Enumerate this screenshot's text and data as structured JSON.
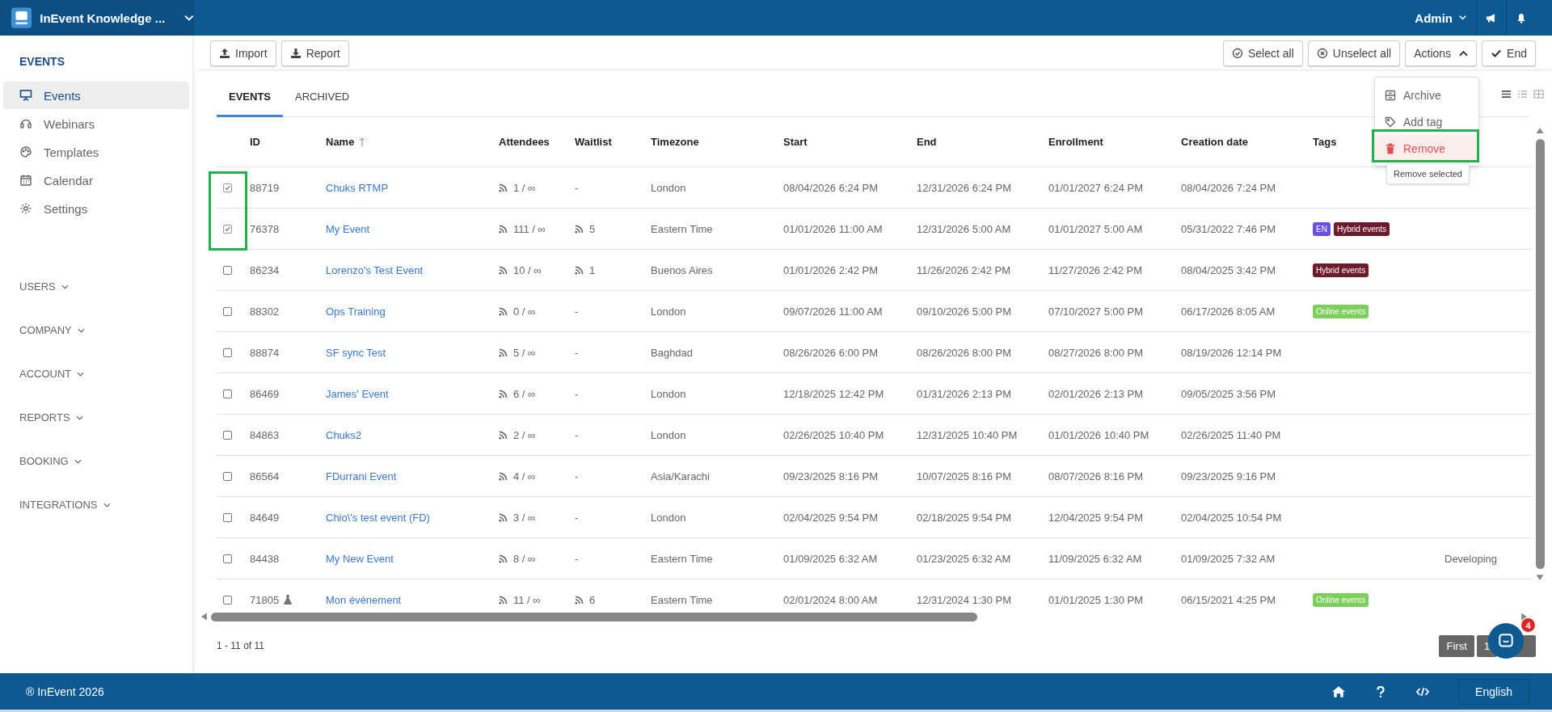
{
  "app_bar": {
    "workspace": "InEvent Knowledge ...",
    "user": "Admin"
  },
  "sidebar": {
    "heading": "EVENTS",
    "items": [
      {
        "label": "Events",
        "selected": true
      },
      {
        "label": "Webinars",
        "selected": false
      },
      {
        "label": "Templates",
        "selected": false
      },
      {
        "label": "Calendar",
        "selected": false
      },
      {
        "label": "Settings",
        "selected": false
      }
    ],
    "sections": [
      "USERS",
      "COMPANY",
      "ACCOUNT",
      "REPORTS",
      "BOOKING",
      "INTEGRATIONS"
    ]
  },
  "toolbar": {
    "import": "Import",
    "report": "Report",
    "select_all": "Select all",
    "unselect_all": "Unselect all",
    "actions": "Actions",
    "actions_expanded": true,
    "end": "End"
  },
  "tabs": [
    {
      "label": "EVENTS",
      "selected": true
    },
    {
      "label": "ARCHIVED",
      "selected": false
    }
  ],
  "actions_menu": {
    "items": [
      {
        "label": "Archive",
        "kind": "normal",
        "hovered": false
      },
      {
        "label": "Add tag",
        "kind": "normal",
        "hovered": false
      },
      {
        "label": "Remove",
        "kind": "danger",
        "hovered": true
      }
    ],
    "tooltip": "Remove selected"
  },
  "table": {
    "columns": [
      {
        "label": "ID",
        "sorted": false
      },
      {
        "label": "Name",
        "sorted": true
      },
      {
        "label": "Attendees",
        "sorted": false
      },
      {
        "label": "Waitlist",
        "sorted": false
      },
      {
        "label": "Timezone",
        "sorted": false
      },
      {
        "label": "Start",
        "sorted": false
      },
      {
        "label": "End",
        "sorted": false
      },
      {
        "label": "Enrollment",
        "sorted": false
      },
      {
        "label": "Creation date",
        "sorted": false
      },
      {
        "label": "Tags",
        "sorted": false
      }
    ],
    "rows": [
      {
        "checked": true,
        "id": "88719",
        "test": false,
        "name": "Chuks RTMP",
        "attendees": "1 / ∞",
        "waitlist": "-",
        "waitlist_feed": false,
        "timezone": "London",
        "start": "08/04/2026 6:24 PM",
        "end": "12/31/2026 6:24 PM",
        "enrollment": "01/01/2027 6:24 PM",
        "created": "08/04/2026 7:24 PM",
        "tags": []
      },
      {
        "checked": true,
        "id": "76378",
        "test": false,
        "name": "My Event",
        "attendees": "111 / ∞",
        "waitlist": "5",
        "waitlist_feed": true,
        "timezone": "Eastern Time",
        "start": "01/01/2026 11:00 AM",
        "end": "12/31/2026 5:00 AM",
        "enrollment": "01/01/2027 5:00 AM",
        "created": "05/31/2022 7:46 PM",
        "tags": [
          {
            "label": "EN",
            "color": "#6b4fe0"
          },
          {
            "label": "Hybrid events",
            "color": "#6d1a2b"
          }
        ]
      },
      {
        "checked": false,
        "id": "86234",
        "test": false,
        "name": "Lorenzo's Test Event",
        "attendees": "10 / ∞",
        "waitlist": "1",
        "waitlist_feed": true,
        "timezone": "Buenos Aires",
        "start": "01/01/2026 2:42 PM",
        "end": "11/26/2026 2:42 PM",
        "enrollment": "11/27/2026 2:42 PM",
        "created": "08/04/2025 3:42 PM",
        "tags": [
          {
            "label": "Hybrid events",
            "color": "#6d1a2b"
          }
        ]
      },
      {
        "checked": false,
        "id": "88302",
        "test": false,
        "name": "Ops Training",
        "attendees": "0 / ∞",
        "waitlist": "-",
        "waitlist_feed": false,
        "timezone": "London",
        "start": "09/07/2026 11:00 AM",
        "end": "09/10/2026 5:00 PM",
        "enrollment": "07/10/2027 5:00 PM",
        "created": "06/17/2026 8:05 AM",
        "tags": [
          {
            "label": "Online events",
            "color": "#7ccf5a"
          }
        ]
      },
      {
        "checked": false,
        "id": "88874",
        "test": false,
        "name": "SF sync Test",
        "attendees": "5 / ∞",
        "waitlist": "-",
        "waitlist_feed": false,
        "timezone": "Baghdad",
        "start": "08/26/2026 6:00 PM",
        "end": "08/26/2026 8:00 PM",
        "enrollment": "08/27/2026 8:00 PM",
        "created": "08/19/2026 12:14 PM",
        "tags": []
      },
      {
        "checked": false,
        "id": "86469",
        "test": false,
        "name": "James' Event",
        "attendees": "6 / ∞",
        "waitlist": "-",
        "waitlist_feed": false,
        "timezone": "London",
        "start": "12/18/2025 12:42 PM",
        "end": "01/31/2026 2:13 PM",
        "enrollment": "02/01/2026 2:13 PM",
        "created": "09/05/2025 3:56 PM",
        "tags": []
      },
      {
        "checked": false,
        "id": "84863",
        "test": false,
        "name": "Chuks2",
        "attendees": "2 / ∞",
        "waitlist": "-",
        "waitlist_feed": false,
        "timezone": "London",
        "start": "02/26/2025 10:40 PM",
        "end": "12/31/2025 10:40 PM",
        "enrollment": "01/01/2026 10:40 PM",
        "created": "02/26/2025 11:40 PM",
        "tags": []
      },
      {
        "checked": false,
        "id": "86564",
        "test": false,
        "name": "FDurrani Event",
        "attendees": "4 / ∞",
        "waitlist": "-",
        "waitlist_feed": false,
        "timezone": "Asia/Karachi",
        "start": "09/23/2025 8:16 PM",
        "end": "10/07/2025 8:16 PM",
        "enrollment": "08/07/2026 8:16 PM",
        "created": "09/23/2025 9:16 PM",
        "tags": []
      },
      {
        "checked": false,
        "id": "84649",
        "test": false,
        "name": "Chio\\'s test event (FD)",
        "attendees": "3 / ∞",
        "waitlist": "-",
        "waitlist_feed": false,
        "timezone": "London",
        "start": "02/04/2025 9:54 PM",
        "end": "02/18/2025 9:54 PM",
        "enrollment": "12/04/2025 9:54 PM",
        "created": "02/04/2025 10:54 PM",
        "tags": []
      },
      {
        "checked": false,
        "id": "84438",
        "test": false,
        "name": "My New Event",
        "attendees": "8 / ∞",
        "waitlist": "-",
        "waitlist_feed": false,
        "timezone": "Eastern Time",
        "start": "01/09/2025 6:32 AM",
        "end": "01/23/2025 6:32 AM",
        "enrollment": "11/09/2025 6:32 AM",
        "created": "01/09/2025 7:32 AM",
        "tags": [],
        "column_11": "Developing"
      },
      {
        "checked": false,
        "id": "71805",
        "test": true,
        "name": "Mon événement",
        "attendees": "11 / ∞",
        "waitlist": "6",
        "waitlist_feed": true,
        "timezone": "Eastern Time",
        "start": "02/01/2024 8:00 AM",
        "end": "12/31/2024 1:30 PM",
        "enrollment": "01/01/2025 1:30 PM",
        "created": "06/15/2021 4:25 PM",
        "tags": [
          {
            "label": "Online events",
            "color": "#7ccf5a"
          }
        ]
      }
    ]
  },
  "pagination": {
    "summary": "1 - 11 of 11",
    "first": "First",
    "page": "1"
  },
  "chat": {
    "badge": "4"
  },
  "footer": {
    "copyright": "® InEvent 2026",
    "language": "English"
  }
}
